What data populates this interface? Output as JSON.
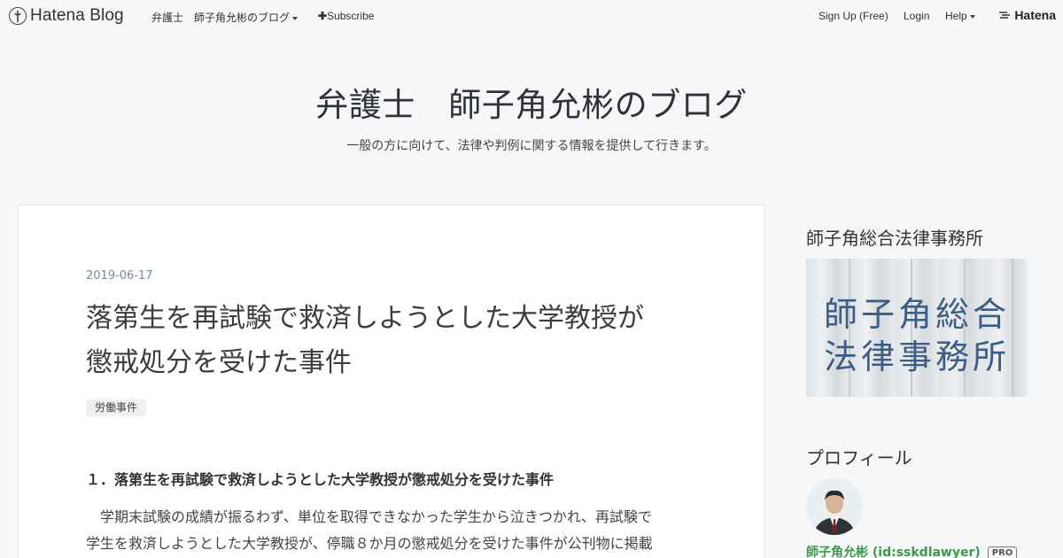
{
  "header": {
    "logo": "Hatena Blog",
    "blog_link": "弁護士",
    "blog_menu": "師子角允彬のブログ",
    "subscribe": "Subscribe",
    "signup": "Sign Up (Free)",
    "login": "Login",
    "help": "Help",
    "hatena": "Hatena"
  },
  "blog": {
    "title": "弁護士　師子角允彬のブログ",
    "description": "一般の方に向けて、法律や判例に関する情報を提供して行きます。"
  },
  "entry": {
    "date": "2019-06-17",
    "title_line1": "落第生を再試験で救済しようとした大学教授が",
    "title_line2": "懲戒処分を受けた事件",
    "category": "労働事件",
    "heading": "１．落第生を再試験で救済しようとした大学教授が懲戒処分を受けた事件",
    "paragraph_line1": "学期末試験の成績が振るわず、単位を取得できなかった学生から泣きつかれ、再試験で",
    "paragraph_line2": "学生を救済しようとした大学教授が、停職８か月の懲戒処分を受けた事件が公刊物に掲載"
  },
  "sidebar": {
    "office_heading": "師子角総合法律事務所",
    "office_image_line1": "師子角総合",
    "office_image_line2": "法律事務所",
    "profile_heading": "プロフィール",
    "profile_name": "師子角允彬 (id:sskdlawyer)",
    "pro_badge": "PRO"
  },
  "colors": {
    "background": "#f6f7f9",
    "card": "#ffffff",
    "date": "#7a8a99",
    "profile_name": "#3a9a4a",
    "office_text": "#3d5c86"
  },
  "icons": [
    "hatena-blog-logo-icon",
    "caret-down-icon",
    "plus-icon",
    "hatena-logo-icon"
  ]
}
